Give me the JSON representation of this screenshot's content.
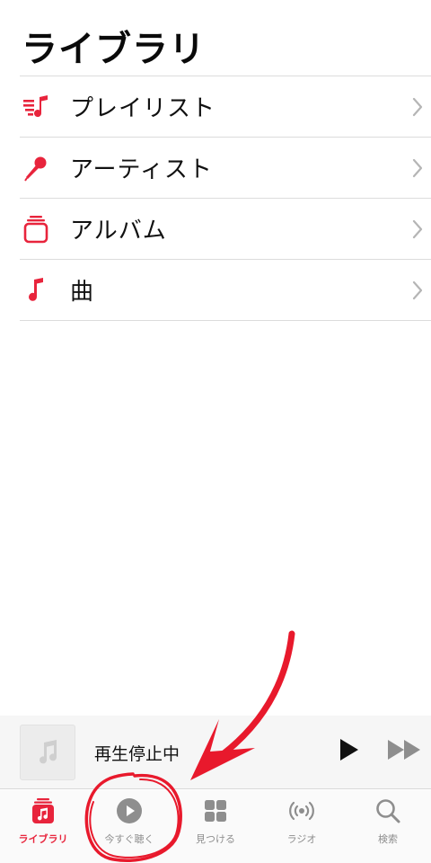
{
  "header": {
    "title": "ライブラリ"
  },
  "library": {
    "items": [
      {
        "label": "プレイリスト",
        "icon": "playlist-icon"
      },
      {
        "label": "アーティスト",
        "icon": "microphone-icon"
      },
      {
        "label": "アルバム",
        "icon": "album-icon"
      },
      {
        "label": "曲",
        "icon": "music-note-icon"
      }
    ]
  },
  "mini_player": {
    "status": "再生停止中"
  },
  "tabs": [
    {
      "label": "ライブラリ",
      "icon": "library-icon",
      "active": true
    },
    {
      "label": "今すぐ聴く",
      "icon": "play-circle-icon",
      "active": false
    },
    {
      "label": "見つける",
      "icon": "grid-icon",
      "active": false
    },
    {
      "label": "ラジオ",
      "icon": "radio-icon",
      "active": false
    },
    {
      "label": "検索",
      "icon": "search-icon",
      "active": false
    }
  ],
  "colors": {
    "accent": "#e8243c",
    "annotation": "#e8192c",
    "tab_inactive": "#8e8e8e",
    "separator": "#dcdcdc"
  }
}
